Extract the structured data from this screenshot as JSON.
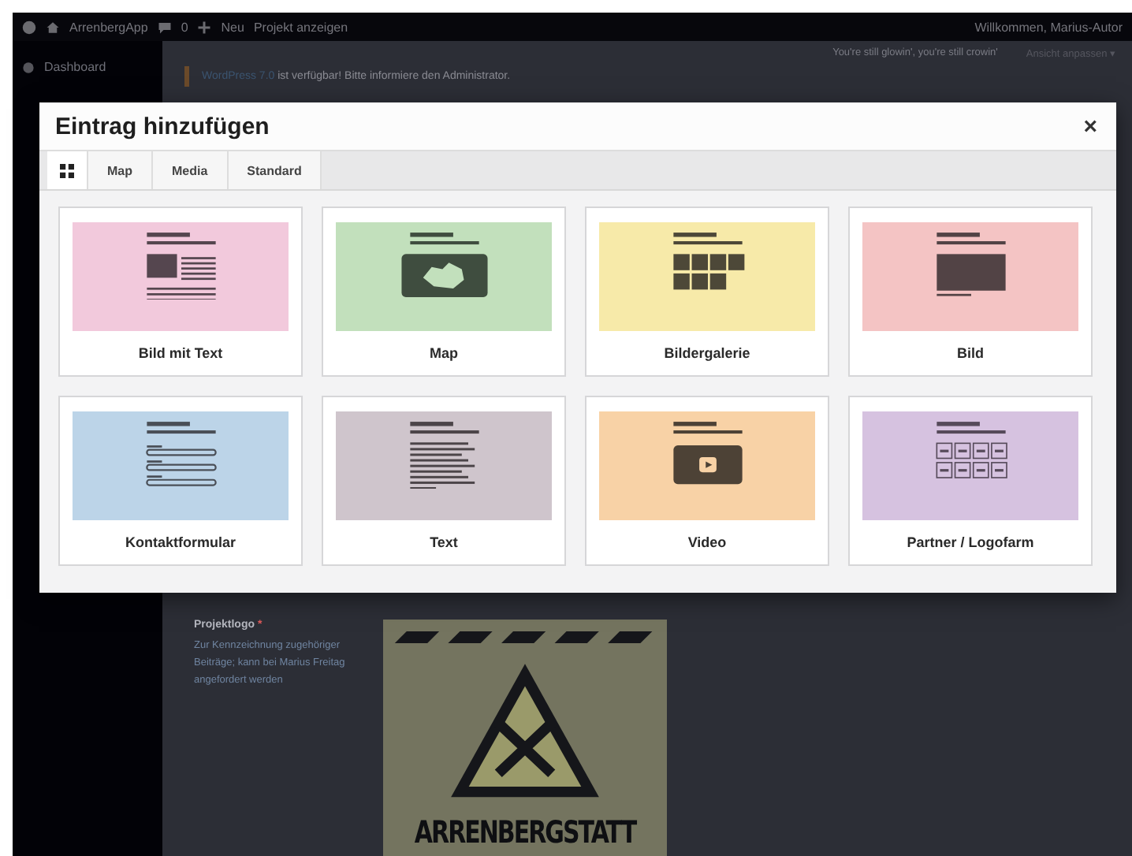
{
  "admin_bar": {
    "site": "ArrenbergApp",
    "comments": "0",
    "new": "Neu",
    "view": "Projekt anzeigen",
    "greeting": "Willkommen, Marius-Autor"
  },
  "sidebar": {
    "items": [
      {
        "label": "Dashboard"
      }
    ]
  },
  "notice": {
    "link": "WordPress 7.0",
    "text": " ist verfügbar! Bitte informiere den Administrator."
  },
  "header_right": {
    "quote": "You're still glowin', you're still crowin'",
    "screen_options": "Ansicht anpassen ▾"
  },
  "field": {
    "label": "Projektlogo",
    "required": "*",
    "description": "Zur Kennzeichnung zugehöriger Beiträge; kann bei Marius Freitag angefordert werden",
    "logo_text": "ARRENBERGSTATT"
  },
  "modal": {
    "title": "Eintrag hinzufügen",
    "close": "×",
    "tabs": [
      {
        "kind": "icon",
        "selected": true
      },
      {
        "kind": "text",
        "label": "Map",
        "selected": false
      },
      {
        "kind": "text",
        "label": "Media",
        "selected": false
      },
      {
        "kind": "text",
        "label": "Standard",
        "selected": false
      }
    ],
    "blocks": [
      {
        "kind": "text-image",
        "label": "Bild mit Text",
        "color": "#f2c9dc"
      },
      {
        "kind": "map",
        "label": "Map",
        "color": "#c2e0bc"
      },
      {
        "kind": "gallery",
        "label": "Bildergalerie",
        "color": "#f7eaa9"
      },
      {
        "kind": "image",
        "label": "Bild",
        "color": "#f4c4c4"
      },
      {
        "kind": "form",
        "label": "Kontaktformular",
        "color": "#bcd4e8"
      },
      {
        "kind": "text",
        "label": "Text",
        "color": "#cfc5cc"
      },
      {
        "kind": "video",
        "label": "Video",
        "color": "#f8d2a6"
      },
      {
        "kind": "logos",
        "label": "Partner / Logofarm",
        "color": "#d6c2e0"
      }
    ]
  }
}
